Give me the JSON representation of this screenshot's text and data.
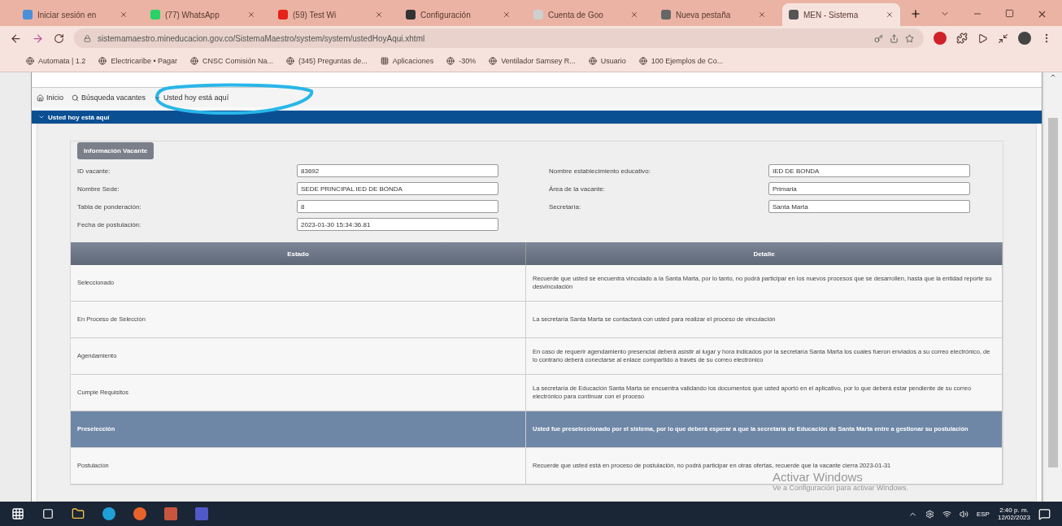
{
  "browser": {
    "tabs": [
      {
        "title": "Iniciar sesión en",
        "selected": false
      },
      {
        "title": "(77) WhatsApp",
        "selected": false
      },
      {
        "title": "(59) Test Wi",
        "selected": false
      },
      {
        "title": "Configuración",
        "selected": false
      },
      {
        "title": "Cuenta de Goo",
        "selected": false
      },
      {
        "title": "Nueva pestaña",
        "selected": false
      },
      {
        "title": "MEN - Sistema",
        "selected": true
      }
    ],
    "address": "sistemamaestro.mineducacion.gov.co/SistemaMaestro/system/system/ustedHoyAqui.xhtml",
    "bookmarks": [
      "Automata | 1.2",
      "Electricaribe • Pagar",
      "CNSC Comisión Na...",
      "(345) Preguntas de...",
      "Aplicaciones",
      "-30%",
      "Ventilador Samsey R...",
      "Usuario",
      "100 Ejemplos de Co..."
    ]
  },
  "page": {
    "breadcrumb": [
      "Inicio",
      "Búsqueda vacantes",
      "Usted hoy está aquí"
    ],
    "panel_title": "Usted hoy está aquí",
    "legend": "Información Vacante",
    "fields_left": [
      {
        "label": "ID vacante:",
        "value": "83692"
      },
      {
        "label": "Nombre Sede:",
        "value": "SEDE PRINCIPAL IED DE BONDA"
      },
      {
        "label": "Tabla de ponderación:",
        "value": "8"
      },
      {
        "label": "Fecha de postulación:",
        "value": "2023-01-30 15:34:36.81"
      }
    ],
    "fields_right": [
      {
        "label": "Nombre establecimiento educativo:",
        "value": "IED DE BONDA"
      },
      {
        "label": "Área de la vacante:",
        "value": "Primaria"
      },
      {
        "label": "Secretaría:",
        "value": "Santa Marta"
      }
    ],
    "table": {
      "columns": [
        "Estado",
        "Detalle"
      ],
      "rows": [
        {
          "estado": "Seleccionado",
          "detalle": "Recuerde que usted se encuentra vinculado a la Santa Marta, por lo tanto, no podrá participar en los nuevos procesos que se desarrollen, hasta que la entidad reporte su desvinculación",
          "selected": false
        },
        {
          "estado": "En Proceso de Selección",
          "detalle": "La secretaría Santa Marta se contactará con usted para realizar el proceso de vinculación",
          "selected": false
        },
        {
          "estado": "Agendamiento",
          "detalle": "En caso de requerir agendamiento presencial deberá asistir al lugar y hora indicados por la secretaría Santa Marta los cuales fueron enviados a su correo electrónico, de lo contrario deberá conectarse al enlace compartido a través de su correo electrónico",
          "selected": false
        },
        {
          "estado": "Cumple Requisitos",
          "detalle": "La secretaría de Educación Santa Marta se encuentra validando los documentos que usted aportó en el aplicativo, por lo que deberá estar pendiente de su correo electrónico para continuar con el proceso",
          "selected": false
        },
        {
          "estado": "Preselección",
          "detalle": "Usted fue preseleccionado por el sistema, por lo que deberá esperar a que la secretaría de Educación de Santa Marta entre a gestionar su postulación",
          "selected": true
        },
        {
          "estado": "Postulación",
          "detalle": "Recuerde que usted está en proceso de postulación, no podrá participar en otras ofertas, recuerde que la vacante cierra 2023-01-31",
          "selected": false
        }
      ]
    }
  },
  "os": {
    "activation": {
      "title": "Activar Windows",
      "subtitle": "Ve a Configuración para activar Windows."
    },
    "taskbar": {
      "language": "ESP",
      "time": "2:40 p. m.",
      "date": "12/02/2023"
    }
  }
}
